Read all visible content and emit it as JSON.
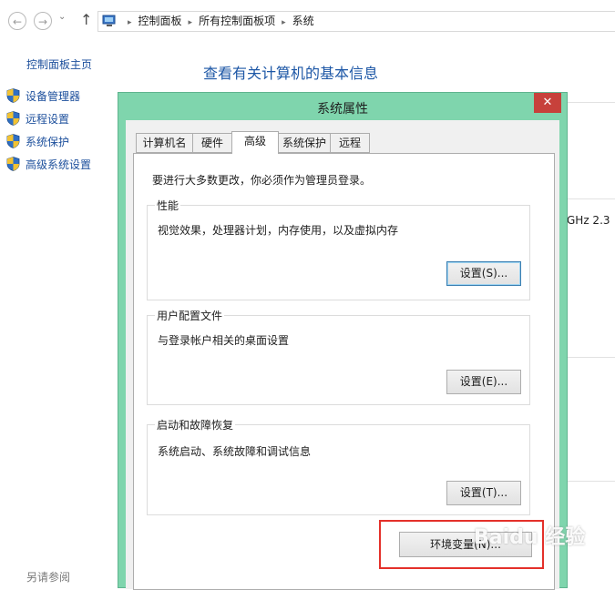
{
  "nav": {
    "back_icon": "arrow-left-icon",
    "forward_icon": "arrow-right-icon",
    "recent_icon": "chevron-down-icon",
    "up_icon": "arrow-up-icon",
    "up_glyph": "↑",
    "back_glyph": "←",
    "forward_glyph": "→",
    "recent_glyph": "⌄",
    "breadcrumbs": [
      "控制面板",
      "所有控制面板项",
      "系统"
    ],
    "separator": "▸"
  },
  "sidebar": {
    "home": "控制面板主页",
    "items": [
      {
        "label": "设备管理器",
        "icon": "shield-icon"
      },
      {
        "label": "远程设置",
        "icon": "shield-icon"
      },
      {
        "label": "系统保护",
        "icon": "shield-icon"
      },
      {
        "label": "高级系统设置",
        "icon": "shield-icon"
      }
    ],
    "see_also": "另请参阅"
  },
  "main": {
    "title": "查看有关计算机的基本信息",
    "processor_fragment": "GHz   2.3"
  },
  "dialog": {
    "title": "系统属性",
    "close_glyph": "✕",
    "tabs": [
      "计算机名",
      "硬件",
      "高级",
      "系统保护",
      "远程"
    ],
    "active_tab": "高级",
    "notice": "要进行大多数更改，你必须作为管理员登录。",
    "groups": [
      {
        "title": "性能",
        "desc": "视觉效果，处理器计划，内存使用，以及虚拟内存",
        "button": "设置(S)..."
      },
      {
        "title": "用户配置文件",
        "desc": "与登录帐户相关的桌面设置",
        "button": "设置(E)..."
      },
      {
        "title": "启动和故障恢复",
        "desc": "系统启动、系统故障和调试信息",
        "button": "设置(T)..."
      }
    ],
    "env_button": "环境变量(N)..."
  },
  "colors": {
    "dialog_frame": "#7fd5ad",
    "close_button": "#c7413b",
    "highlight_box": "#e4302a",
    "link": "#1c4f9c"
  },
  "watermark": "Baidu 经验"
}
